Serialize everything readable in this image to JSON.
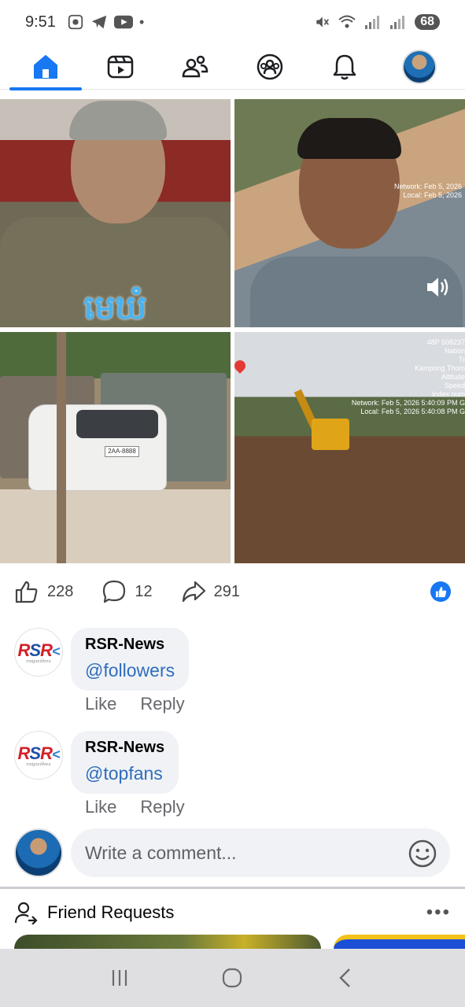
{
  "status_bar": {
    "time": "9:51",
    "battery": "68",
    "left_icons": [
      "screen-record-icon",
      "telegram-icon",
      "youtube-icon",
      "dot-icon"
    ],
    "right_icons": [
      "mute-icon",
      "wifi-icon",
      "signal-icon",
      "signal-icon"
    ]
  },
  "nav": {
    "items": [
      {
        "name": "home",
        "icon": "home-icon",
        "active": true
      },
      {
        "name": "video",
        "icon": "video-icon",
        "active": false
      },
      {
        "name": "friends",
        "icon": "friends-icon",
        "active": false
      },
      {
        "name": "groups",
        "icon": "groups-icon",
        "active": false
      },
      {
        "name": "notifications",
        "icon": "bell-icon",
        "active": false
      },
      {
        "name": "profile",
        "icon": "profile-avatar",
        "active": false
      }
    ]
  },
  "post": {
    "photos": [
      {
        "caption": "មេឃំ"
      },
      {
        "overlay": "Network: Feb 5, 2026\nLocal: Feb 5, 2026"
      },
      {
        "plate": "2AA-8888"
      },
      {
        "overlay": "48P 508237\nNation\nTr\nKampong Thom\nAltitude\nSpeed\nIndex num\nNetwork: Feb 5, 2026 5:40:09 PM G\nLocal: Feb 5, 2026 5:40:08 PM G"
      }
    ],
    "likes": "228",
    "comments": "12",
    "shares": "291",
    "accent": "#1877f2"
  },
  "comments": [
    {
      "author": "RSR-News",
      "text": "@followers",
      "like": "Like",
      "reply": "Reply"
    },
    {
      "author": "RSR-News",
      "text": "@topfans",
      "like": "Like",
      "reply": "Reply"
    }
  ],
  "rsr_logo": {
    "main": "RSR",
    "sub": "ការផ្សាយព័ត៌មាន"
  },
  "write_comment": {
    "placeholder": "Write a comment..."
  },
  "friend_requests": {
    "title": "Friend Requests",
    "more": "•••"
  },
  "system_nav": {
    "icons": [
      "recent-apps-icon",
      "home-button-icon",
      "back-icon"
    ]
  }
}
